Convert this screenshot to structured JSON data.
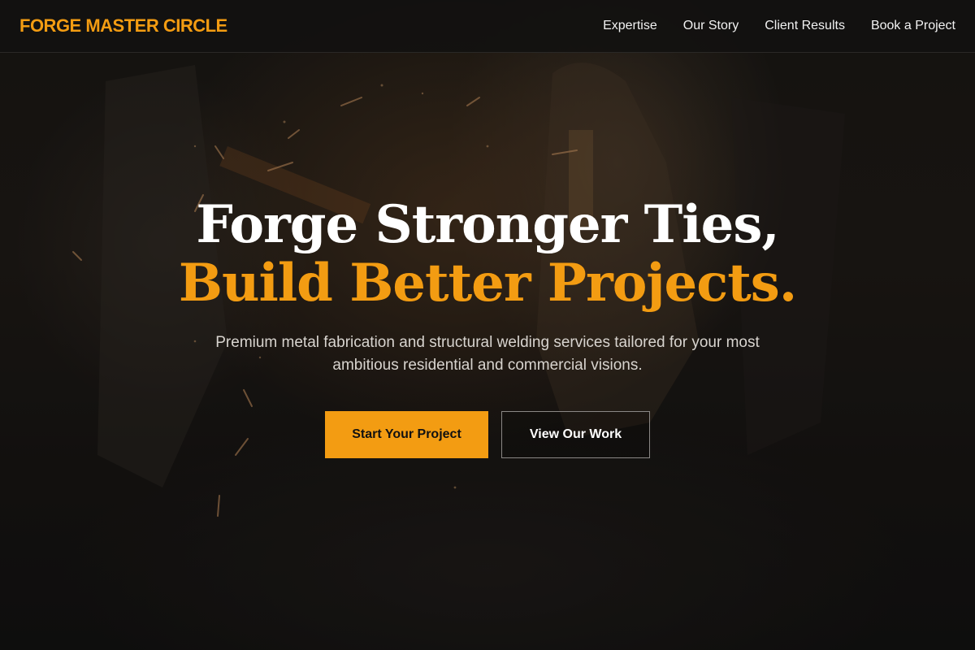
{
  "nav": {
    "logo": "FORGE MASTER CIRCLE",
    "links": [
      {
        "label": "Expertise"
      },
      {
        "label": "Our Story"
      },
      {
        "label": "Client Results"
      },
      {
        "label": "Book a Project"
      }
    ]
  },
  "hero": {
    "headline_line1": "Forge Stronger Ties,",
    "headline_line2": "Build Better Projects.",
    "subtitle": "Premium metal fabrication and structural welding services tailored for your most ambitious residential and commercial visions.",
    "primary_cta": "Start Your Project",
    "secondary_cta": "View Our Work",
    "background_image": "welding-workshop-sparks"
  },
  "colors": {
    "accent": "#f39c12",
    "background": "#141210",
    "text": "#ffffff"
  }
}
